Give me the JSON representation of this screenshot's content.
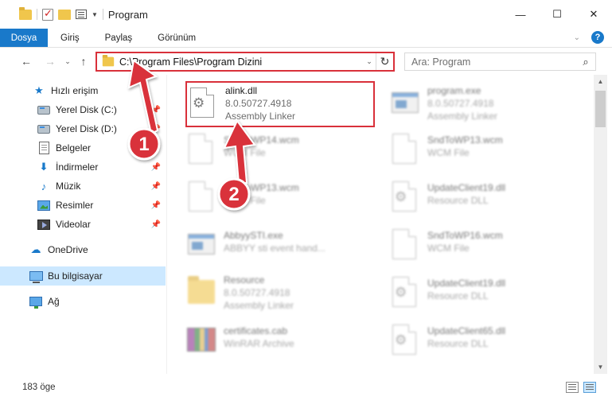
{
  "window": {
    "title": "Program",
    "minimize": "—",
    "maximize": "☐",
    "close": "✕"
  },
  "ribbon": {
    "tabs": [
      {
        "label": "Dosya"
      },
      {
        "label": "Giriş"
      },
      {
        "label": "Paylaş"
      },
      {
        "label": "Görünüm"
      }
    ],
    "help": "?"
  },
  "nav": {
    "back": "←",
    "forward": "→",
    "recent": "⌄",
    "up": "↑"
  },
  "address": {
    "path": "C:\\Program Files\\Program Dizini",
    "dropdown": "⌄",
    "refresh": "↻"
  },
  "search": {
    "placeholder": "Ara: Program",
    "icon": "⌕"
  },
  "sidebar": {
    "items": [
      {
        "label": "Hızlı erişim",
        "icon": "star-icon"
      },
      {
        "label": "Yerel Disk (C:)",
        "icon": "disk-icon",
        "pinned": true
      },
      {
        "label": "Yerel Disk (D:)",
        "icon": "disk-icon",
        "pinned": true
      },
      {
        "label": "Belgeler",
        "icon": "document-icon",
        "pinned": true
      },
      {
        "label": "İndirmeler",
        "icon": "download-icon",
        "pinned": true
      },
      {
        "label": "Müzik",
        "icon": "music-icon",
        "pinned": true
      },
      {
        "label": "Resimler",
        "icon": "pictures-icon",
        "pinned": true
      },
      {
        "label": "Videolar",
        "icon": "videos-icon",
        "pinned": true
      },
      {
        "label": "OneDrive",
        "icon": "cloud-icon"
      },
      {
        "label": "Bu bilgisayar",
        "icon": "computer-icon",
        "selected": true
      },
      {
        "label": "Ağ",
        "icon": "network-icon"
      }
    ],
    "pin_glyph": "📌"
  },
  "files": [
    {
      "name": "alink.dll",
      "line2": "8.0.50727.4918",
      "line3": "Assembly Linker",
      "icon": "dll-file-icon"
    },
    {
      "name": "program.exe",
      "line2": "8.0.50727.4918",
      "line3": "Assembly Linker",
      "icon": "exe-file-icon"
    },
    {
      "name": "SndToWP14.wcm",
      "line2": "WCM File",
      "line3": "",
      "icon": "generic-file-icon"
    },
    {
      "name": "SndToWP13.wcm",
      "line2": "WCM File",
      "line3": "",
      "icon": "generic-file-icon"
    },
    {
      "name": "SndToWP13.wcm",
      "line2": "WCM File",
      "line3": "",
      "icon": "generic-file-icon"
    },
    {
      "name": "UpdateClient19.dll",
      "line2": "Resource DLL",
      "line3": "",
      "icon": "dll-file-icon"
    },
    {
      "name": "AbbyySTI.exe",
      "line2": "ABBYY sti event hand...",
      "line3": "",
      "icon": "exe-file-icon"
    },
    {
      "name": "SndToWP16.wcm",
      "line2": "WCM File",
      "line3": "",
      "icon": "generic-file-icon"
    },
    {
      "name": "Resource",
      "line2": "8.0.50727.4918",
      "line3": "Assembly Linker",
      "icon": "folder-icon"
    },
    {
      "name": "UpdateClient19.dll",
      "line2": "Resource DLL",
      "line3": "",
      "icon": "dll-file-icon"
    },
    {
      "name": "certificates.cab",
      "line2": "WinRAR Archive",
      "line3": "",
      "icon": "archive-file-icon"
    },
    {
      "name": "UpdateClient65.dll",
      "line2": "Resource DLL",
      "line3": "",
      "icon": "dll-file-icon"
    }
  ],
  "annotations": {
    "step1": "1",
    "step2": "2",
    "color": "#d9303a"
  },
  "status": {
    "count": "183 öge"
  },
  "colors": {
    "accent": "#1979ca",
    "selection": "#cce8ff",
    "highlight": "#d9303a"
  }
}
